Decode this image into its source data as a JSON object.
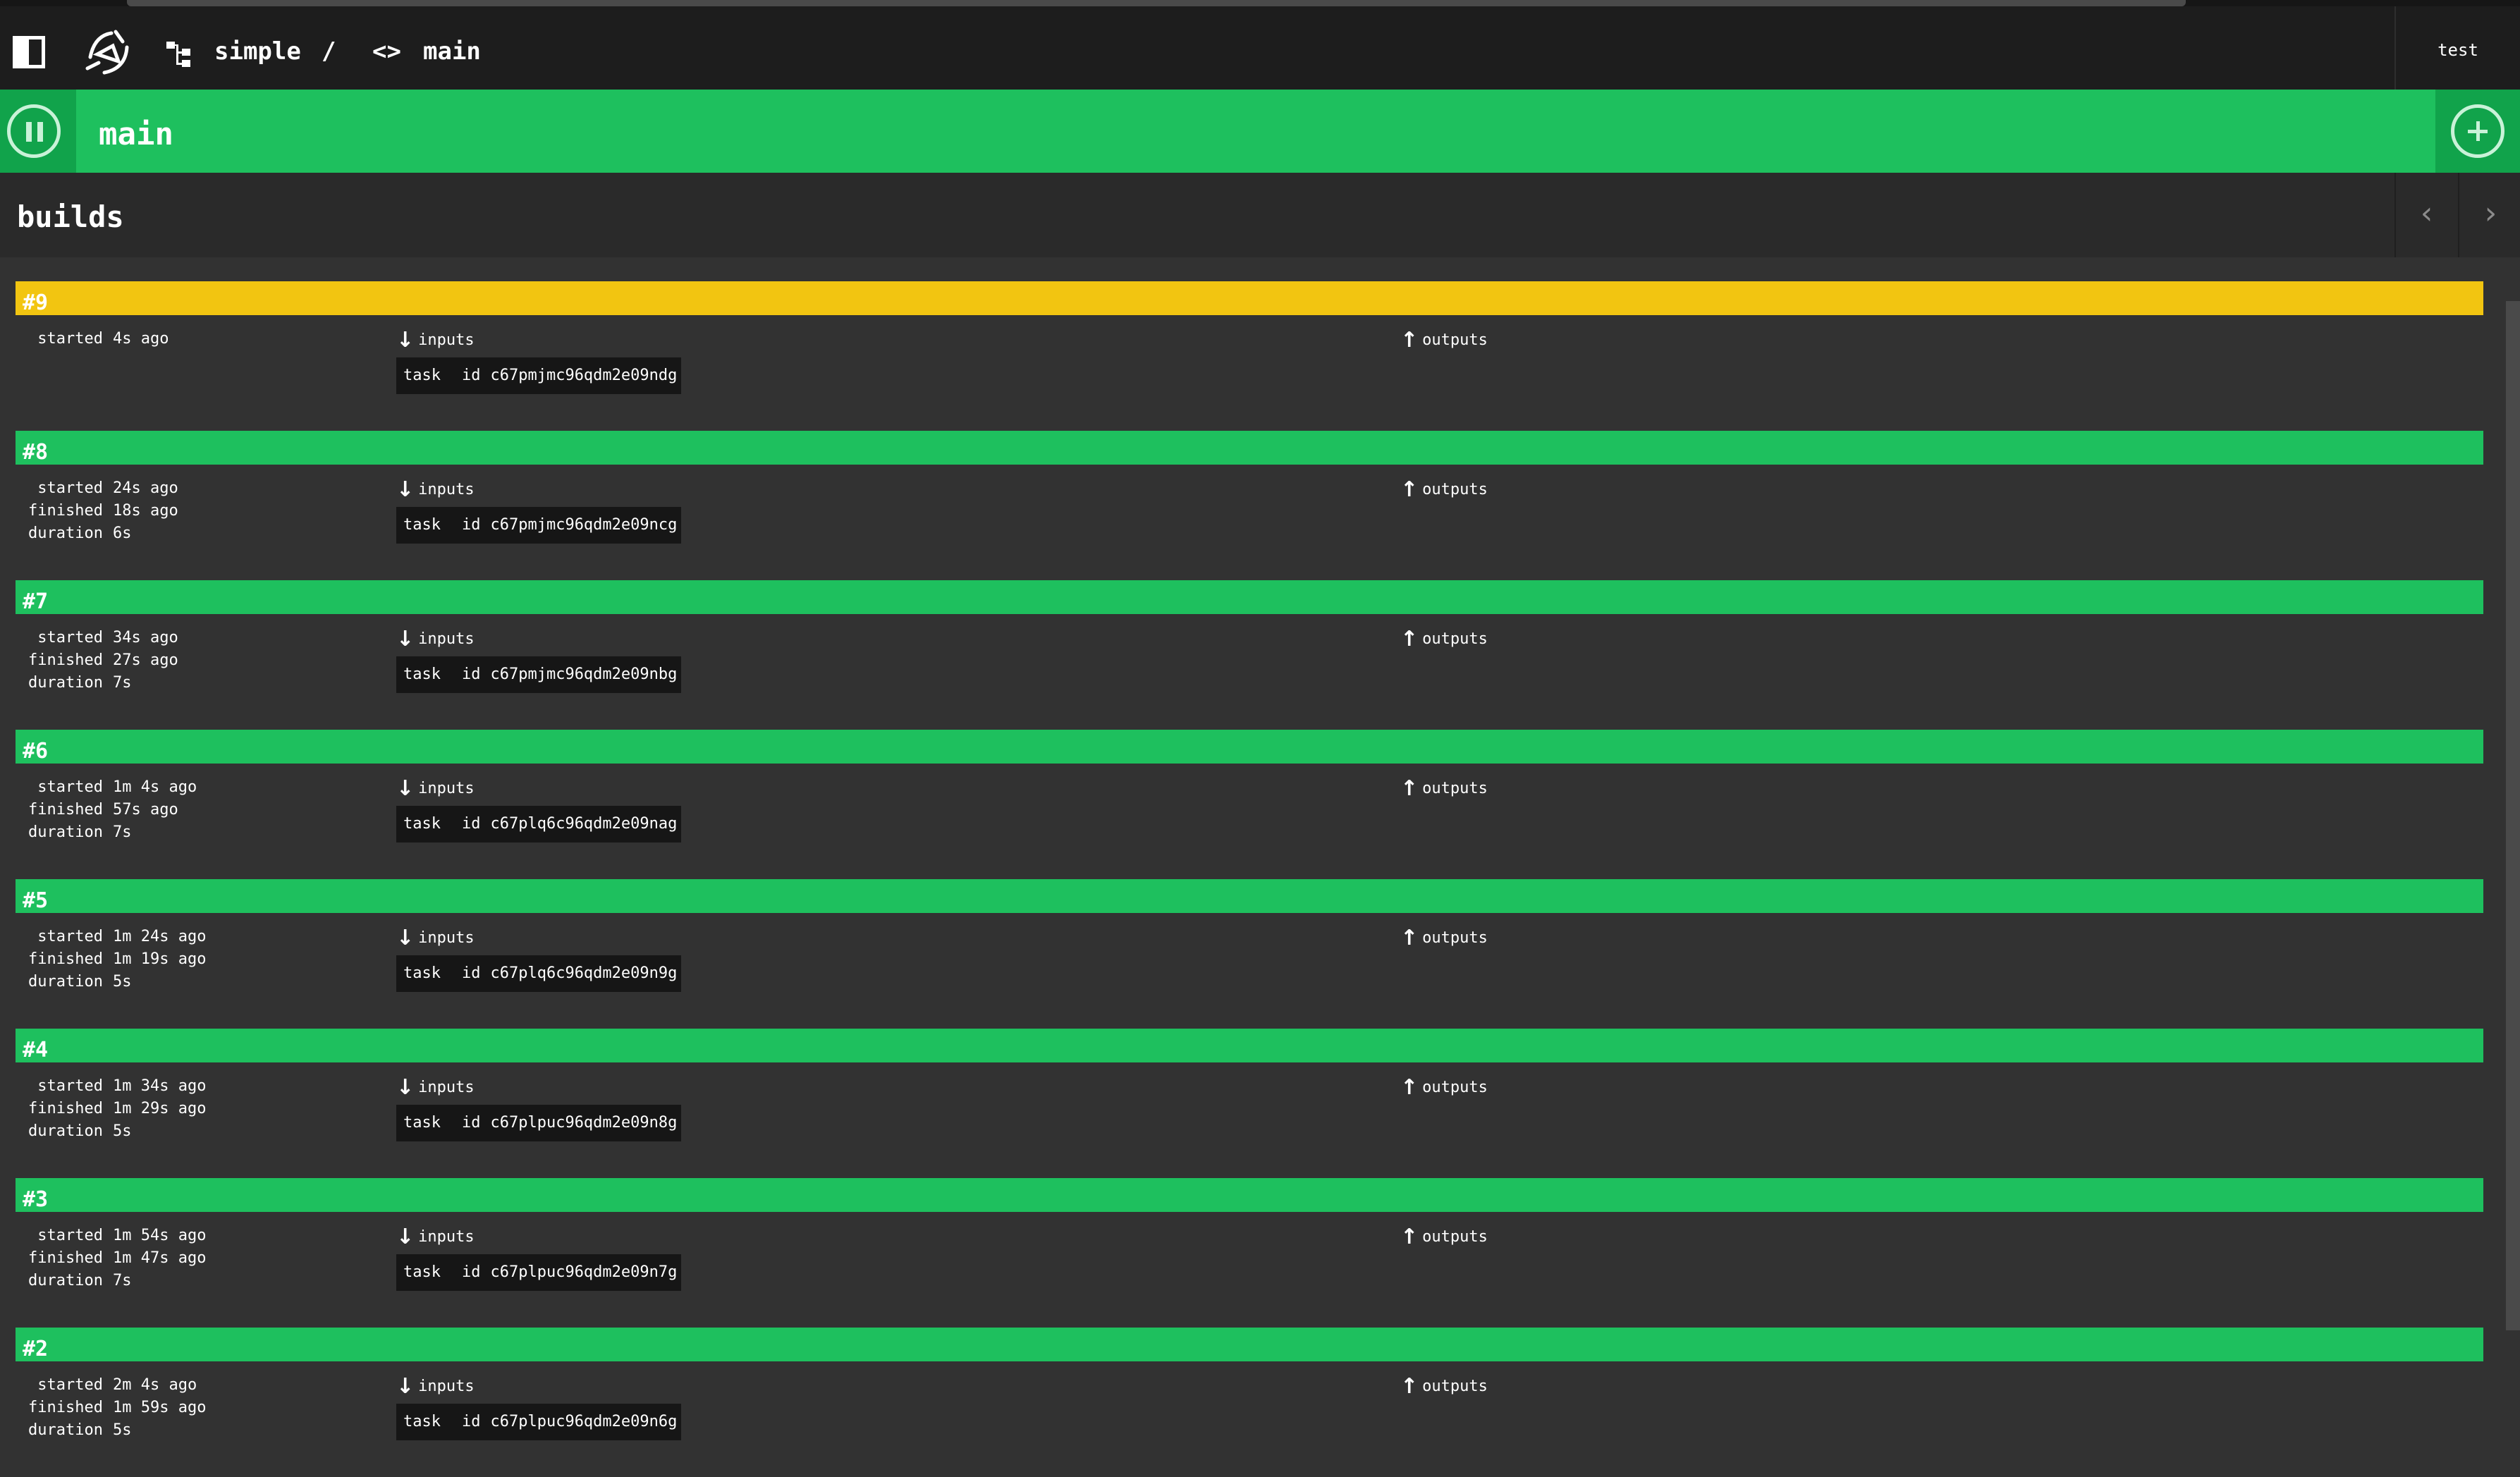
{
  "top_bar": {
    "pipeline": "simple",
    "separator": "/",
    "job_icon": "<>",
    "job": "main",
    "user": "test",
    "icons": [
      "sidebar-toggle-icon",
      "concourse-logo-icon",
      "pipeline-icon",
      "job-icon"
    ]
  },
  "job_header": {
    "title": "main",
    "pause_icon": "pause-circle-icon",
    "trigger_icon": "plus-circle-icon"
  },
  "builds_header": {
    "title": "builds",
    "prev": "‹",
    "next": "›"
  },
  "labels": {
    "started": "started",
    "finished": "finished",
    "duration": "duration",
    "inputs": "inputs",
    "outputs": "outputs",
    "input_name": "task",
    "input_key": "id",
    "arrow_in": "↓",
    "arrow_out": "↑"
  },
  "colors": {
    "succeeded": "#1ec05e",
    "started": "#f2c511",
    "background": "#323232"
  },
  "builds": [
    {
      "number": "#9",
      "status": "started",
      "started": "4s ago",
      "input_id": "c67pmjmc96qdm2e09ndg"
    },
    {
      "number": "#8",
      "status": "succeeded",
      "started": "24s ago",
      "finished": "18s ago",
      "duration": "6s",
      "input_id": "c67pmjmc96qdm2e09ncg"
    },
    {
      "number": "#7",
      "status": "succeeded",
      "started": "34s ago",
      "finished": "27s ago",
      "duration": "7s",
      "input_id": "c67pmjmc96qdm2e09nbg"
    },
    {
      "number": "#6",
      "status": "succeeded",
      "started": "1m 4s ago",
      "finished": "57s ago",
      "duration": "7s",
      "input_id": "c67plq6c96qdm2e09nag"
    },
    {
      "number": "#5",
      "status": "succeeded",
      "started": "1m 24s ago",
      "finished": "1m 19s ago",
      "duration": "5s",
      "input_id": "c67plq6c96qdm2e09n9g"
    },
    {
      "number": "#4",
      "status": "succeeded",
      "started": "1m 34s ago",
      "finished": "1m 29s ago",
      "duration": "5s",
      "input_id": "c67plpuc96qdm2e09n8g"
    },
    {
      "number": "#3",
      "status": "succeeded",
      "started": "1m 54s ago",
      "finished": "1m 47s ago",
      "duration": "7s",
      "input_id": "c67plpuc96qdm2e09n7g"
    },
    {
      "number": "#2",
      "status": "succeeded",
      "started": "2m 4s ago",
      "finished": "1m 59s ago",
      "duration": "5s",
      "input_id": "c67plpuc96qdm2e09n6g"
    }
  ]
}
